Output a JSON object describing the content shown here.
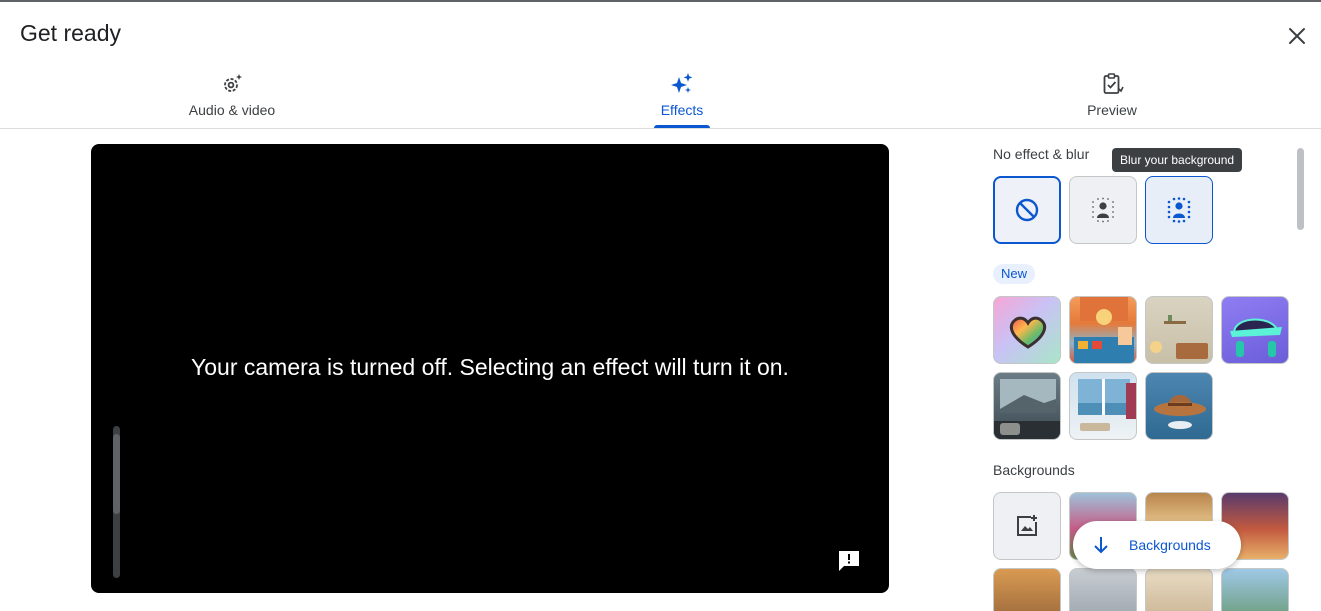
{
  "dialog": {
    "title": "Get ready",
    "close_icon": "close-icon"
  },
  "tabs": [
    {
      "label": "Audio & video",
      "icon": "settings-sparkle-icon",
      "active": false
    },
    {
      "label": "Effects",
      "icon": "sparkle-icon",
      "active": true
    },
    {
      "label": "Preview",
      "icon": "clipboard-check-icon",
      "active": false
    }
  ],
  "video": {
    "message": "Your camera is turned off. Selecting an effect will turn it on.",
    "feedback_icon": "feedback-icon"
  },
  "effects": {
    "no_effect_section": {
      "title": "No effect & blur",
      "options": [
        {
          "name": "no-effect",
          "icon": "block-icon",
          "selected": true
        },
        {
          "name": "slight-blur",
          "icon": "person-blur-slight-icon",
          "selected": false
        },
        {
          "name": "blur-background",
          "icon": "person-blur-icon",
          "selected": false
        }
      ]
    },
    "tooltip": "Blur your background",
    "new_section": {
      "badge": "New",
      "items": [
        {
          "name": "heart-effect"
        },
        {
          "name": "kitchen-scene"
        },
        {
          "name": "living-room-scene"
        },
        {
          "name": "cyber-hat-effect"
        },
        {
          "name": "balcony-scene"
        },
        {
          "name": "seaside-room-scene"
        },
        {
          "name": "cowboy-hat-effect"
        }
      ]
    },
    "backgrounds_section": {
      "title": "Backgrounds",
      "upload_icon": "add-photo-icon",
      "items": [
        {
          "name": "floral-background"
        },
        {
          "name": "interior-background"
        },
        {
          "name": "string-lights-background"
        }
      ]
    },
    "jump_button": {
      "label": "Backgrounds",
      "icon": "arrow-down-icon"
    }
  },
  "colors": {
    "accent": "#0b57d0",
    "text": "#202124",
    "video_bg": "#000000",
    "tooltip_bg": "#3c4043"
  }
}
